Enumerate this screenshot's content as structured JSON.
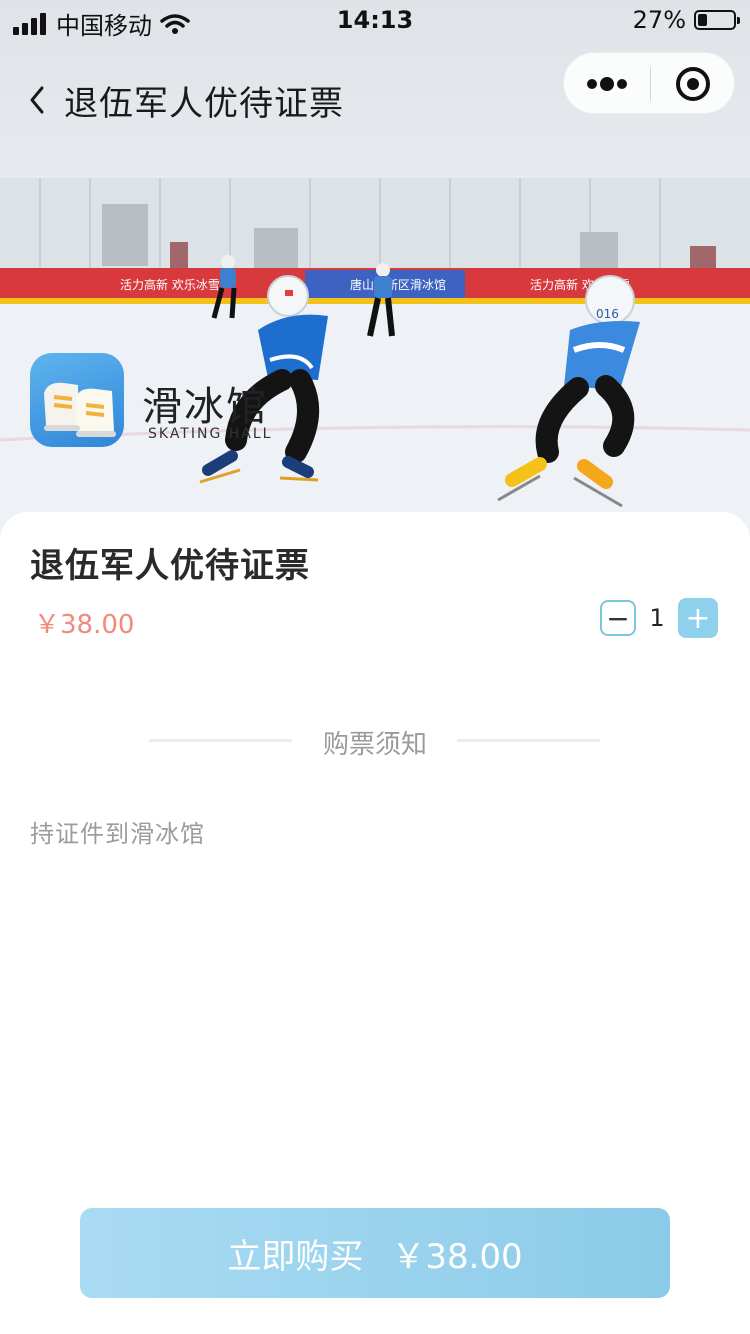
{
  "status_bar": {
    "carrier": "中国移动",
    "time": "14:13",
    "battery": "27%"
  },
  "nav": {
    "title": "退伍军人优待证票"
  },
  "banner": {
    "logo_name": "滑冰馆",
    "logo_subtitle": "SKATING HALL",
    "rink_banners": [
      "活力高新 欢乐冰雪",
      "唐山高新区滑冰馆",
      "活力高新 欢乐冰雪"
    ],
    "helmet_number": "016"
  },
  "product": {
    "title": "退伍军人优待证票",
    "price": "￥38.00",
    "quantity": "1",
    "minus_label": "−",
    "plus_label": "+"
  },
  "notice": {
    "title": "购票须知",
    "body": "持证件到滑冰馆"
  },
  "footer": {
    "buy_label": "立即购买",
    "buy_price": "￥38.00"
  },
  "colors": {
    "price": "#f08a7c",
    "accent": "#8fd0ec",
    "button": "#8ccbe8"
  }
}
